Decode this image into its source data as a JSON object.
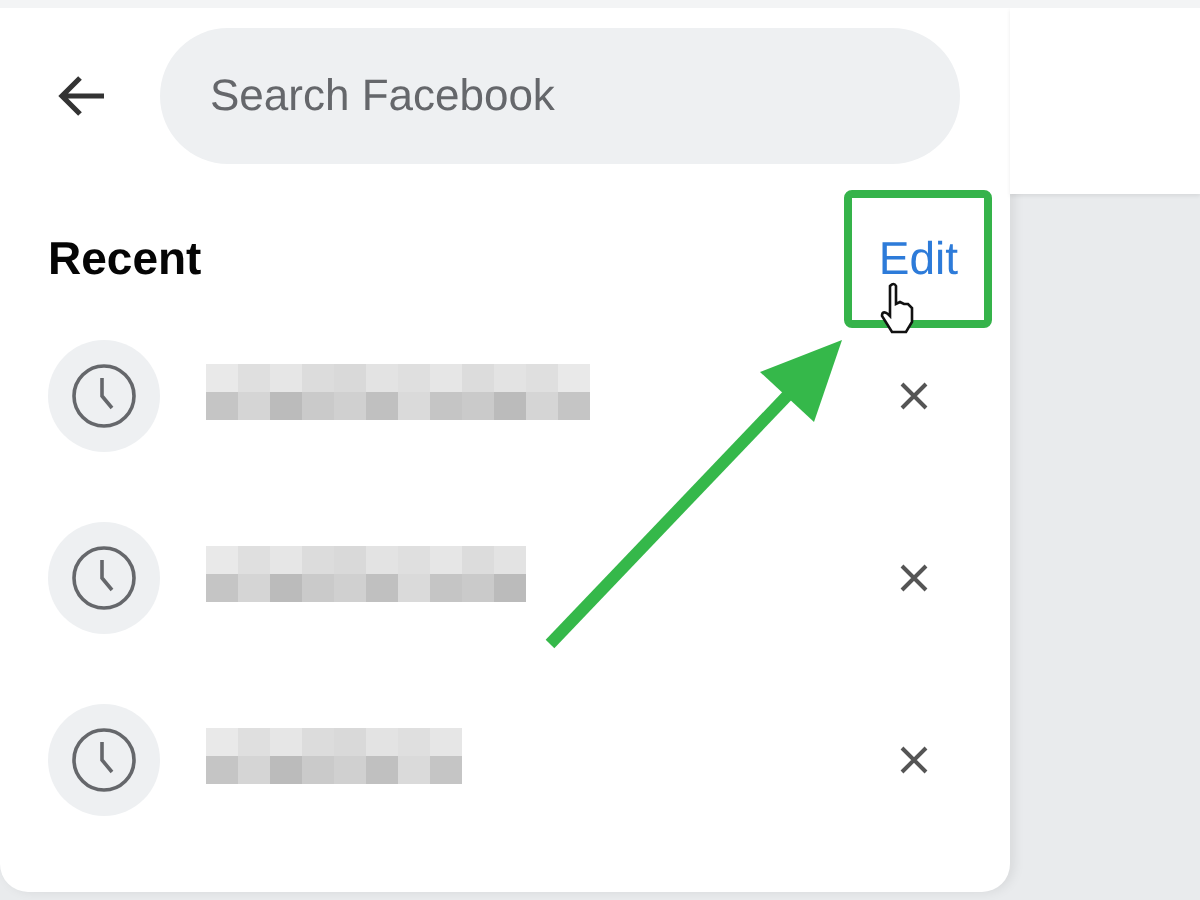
{
  "search": {
    "placeholder": "Search Facebook"
  },
  "recent": {
    "title": "Recent",
    "edit_link": "Edit",
    "highlighted": true
  },
  "items": [
    {
      "kind": "redacted"
    },
    {
      "kind": "redacted"
    },
    {
      "kind": "redacted"
    }
  ]
}
